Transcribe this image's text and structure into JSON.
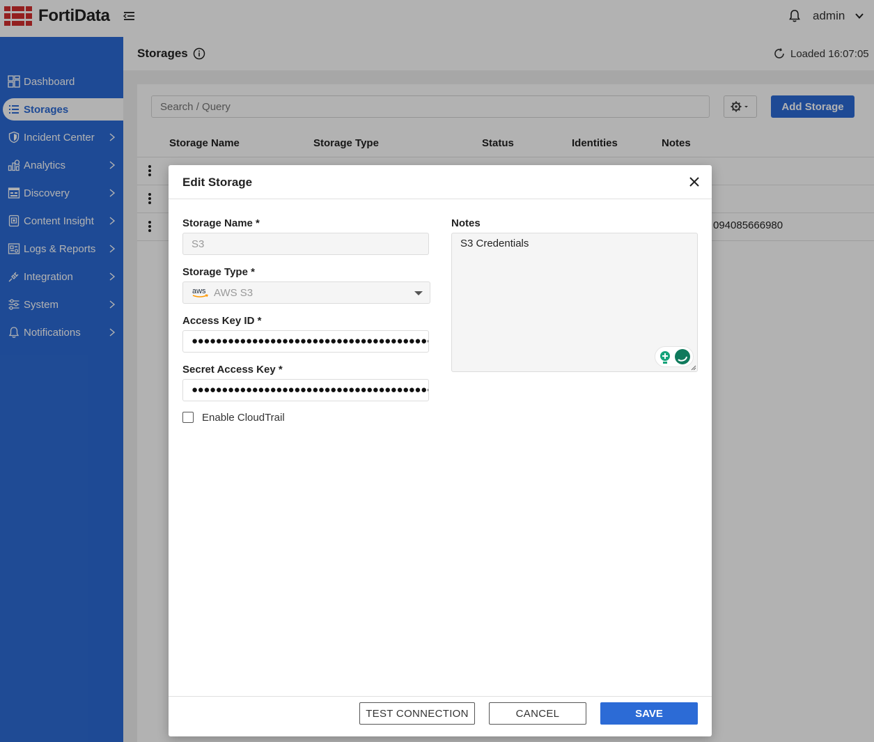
{
  "app": {
    "brand": "FortiData",
    "user": "admin"
  },
  "sidebar": {
    "items": [
      {
        "label": "Dashboard"
      },
      {
        "label": "Storages"
      },
      {
        "label": "Incident Center"
      },
      {
        "label": "Analytics"
      },
      {
        "label": "Discovery"
      },
      {
        "label": "Content Insight"
      },
      {
        "label": "Logs & Reports"
      },
      {
        "label": "Integration"
      },
      {
        "label": "System"
      },
      {
        "label": "Notifications"
      }
    ]
  },
  "page": {
    "title": "Storages",
    "loaded_label": "Loaded",
    "loaded_time": "16:07:05"
  },
  "toolbar": {
    "search_placeholder": "Search / Query",
    "add_label": "Add Storage"
  },
  "table": {
    "columns": [
      "Storage Name",
      "Storage Type",
      "Status",
      "Identities",
      "Notes"
    ],
    "visible_cell": "094085666980"
  },
  "modal": {
    "title": "Edit Storage",
    "storage_name_label": "Storage Name *",
    "storage_name_value": "S3",
    "storage_type_label": "Storage Type *",
    "storage_type_logo": "aws",
    "storage_type_value": "AWS S3",
    "access_key_label": "Access Key ID *",
    "access_key_mask": "●●●●●●●●●●●●●●●●●●●●●●●●●●●●●●●●●●●●●●●●●●●●●●●●●●",
    "secret_key_label": "Secret Access Key *",
    "secret_key_mask": "●●●●●●●●●●●●●●●●●●●●●●●●●●●●●●●●●●●●●●●●●●●●●●●●●●",
    "cloudtrail_label": "Enable CloudTrail",
    "cloudtrail_checked": false,
    "notes_label": "Notes",
    "notes_value": "S3 Credentials",
    "test_label": "TEST CONNECTION",
    "cancel_label": "CANCEL",
    "save_label": "SAVE"
  },
  "colors": {
    "primary": "#2c6bd6",
    "logo_red": "#d32f2f",
    "grammar_green": "#15a37a"
  }
}
